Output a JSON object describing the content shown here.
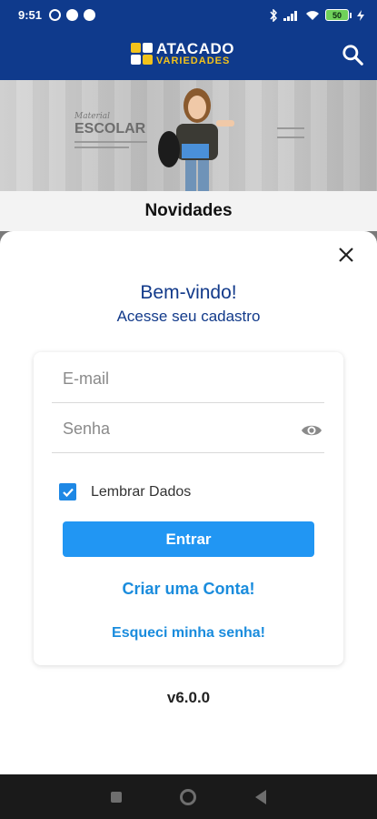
{
  "status_bar": {
    "time": "9:51",
    "battery_level": "50",
    "icons": [
      "alarm-icon",
      "app-notification-icon",
      "app-notification-icon",
      "bluetooth-icon",
      "signal-icon",
      "wifi-icon",
      "battery-icon",
      "charging-icon"
    ]
  },
  "header": {
    "logo_line1": "ATACADO",
    "logo_line2": "VARIEDADES",
    "search_icon": "search-icon",
    "brand_color": "#0f3a8c",
    "accent_color": "#f2c21b"
  },
  "banner": {
    "title_small": "Material",
    "title_main": "ESCOLAR"
  },
  "section": {
    "title": "Novidades"
  },
  "login_modal": {
    "close_icon": "close-icon",
    "welcome": "Bem-vindo!",
    "subtitle": "Acesse seu cadastro",
    "email_placeholder": "E-mail",
    "email_value": "",
    "password_placeholder": "Senha",
    "password_value": "",
    "show_password_icon": "eye-icon",
    "remember_label": "Lembrar Dados",
    "remember_checked": true,
    "submit_label": "Entrar",
    "create_account_label": "Criar uma Conta!",
    "forgot_password_label": "Esqueci minha senha!",
    "button_color": "#2196f3",
    "link_color": "#1a8cdd"
  },
  "version": "v6.0.0",
  "nav_bar": {
    "buttons": [
      "recent-apps-icon",
      "home-icon",
      "back-icon"
    ]
  }
}
